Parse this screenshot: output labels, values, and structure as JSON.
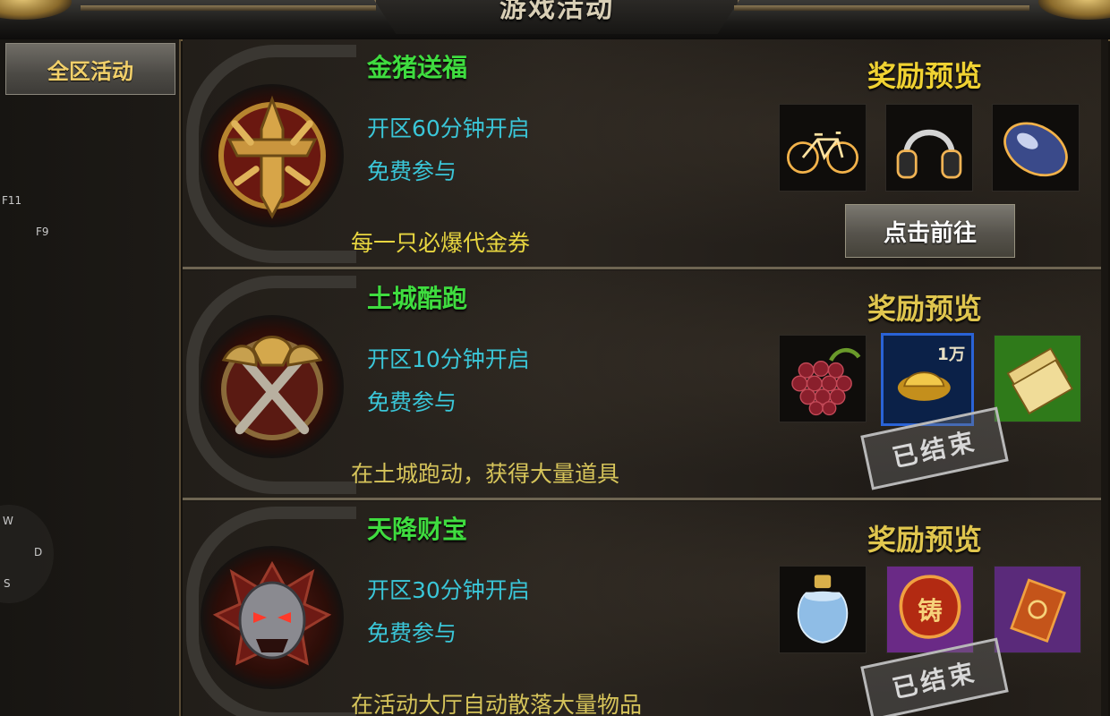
{
  "window": {
    "title": "游戏活动"
  },
  "sidebar": {
    "tab_label": "全区活动",
    "hotkeys": [
      "F11",
      "F9"
    ],
    "movement_keys": [
      "W",
      "D",
      "S"
    ]
  },
  "activities": [
    {
      "title": "金猪送福",
      "open_time": "开区60分钟开启",
      "entry": "免费参与",
      "description": "每一只必爆代金券",
      "reward_label": "奖励预览",
      "rewards": [
        "bicycle-icon",
        "headphones-icon",
        "mouse-icon"
      ],
      "action_label": "点击前往",
      "status": ""
    },
    {
      "title": "土城酷跑",
      "open_time": "开区10分钟开启",
      "entry": "免费参与",
      "description": "在土城跑动，获得大量道具",
      "reward_label": "奖励预览",
      "rewards": [
        "grapes-icon",
        "gold-ingot-icon",
        "ticket-icon"
      ],
      "ingot_amount": "1万",
      "status": "已结束"
    },
    {
      "title": "天降财宝",
      "open_time": "开区30分钟开启",
      "entry": "免费参与",
      "description": "在活动大厅自动散落大量物品",
      "reward_label": "奖励预览",
      "rewards": [
        "perfume-bottle-icon",
        "forge-token-icon",
        "scroll-icon"
      ],
      "forge_char": "铸",
      "status": "已结束"
    }
  ],
  "colors": {
    "title_green": "#3fdc3f",
    "info_cyan": "#3ac6d8",
    "desc_yellow": "#e8d640",
    "reward_gold": "#f0d232"
  }
}
